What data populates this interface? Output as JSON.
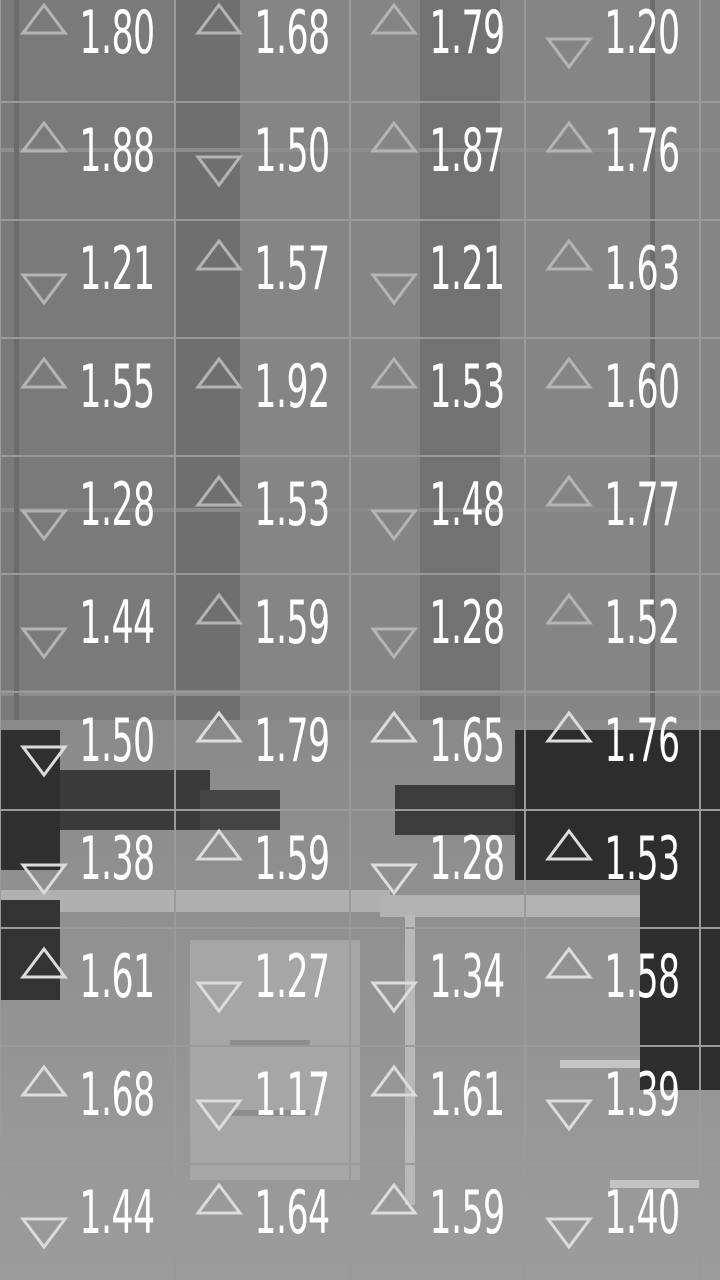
{
  "columns": 4,
  "ticker": [
    [
      {
        "value": "1.80",
        "trend": "up"
      },
      {
        "value": "1.68",
        "trend": "up"
      },
      {
        "value": "1.79",
        "trend": "up"
      },
      {
        "value": "1.20",
        "trend": "down"
      }
    ],
    [
      {
        "value": "1.88",
        "trend": "up"
      },
      {
        "value": "1.50",
        "trend": "down"
      },
      {
        "value": "1.87",
        "trend": "up"
      },
      {
        "value": "1.76",
        "trend": "up"
      }
    ],
    [
      {
        "value": "1.21",
        "trend": "down"
      },
      {
        "value": "1.57",
        "trend": "up"
      },
      {
        "value": "1.21",
        "trend": "down"
      },
      {
        "value": "1.63",
        "trend": "up"
      }
    ],
    [
      {
        "value": "1.55",
        "trend": "up"
      },
      {
        "value": "1.92",
        "trend": "up"
      },
      {
        "value": "1.53",
        "trend": "up"
      },
      {
        "value": "1.60",
        "trend": "up"
      }
    ],
    [
      {
        "value": "1.28",
        "trend": "down"
      },
      {
        "value": "1.53",
        "trend": "up"
      },
      {
        "value": "1.48",
        "trend": "down"
      },
      {
        "value": "1.77",
        "trend": "up"
      }
    ],
    [
      {
        "value": "1.44",
        "trend": "down"
      },
      {
        "value": "1.59",
        "trend": "up"
      },
      {
        "value": "1.28",
        "trend": "down"
      },
      {
        "value": "1.52",
        "trend": "up"
      }
    ],
    [
      {
        "value": "1.50",
        "trend": "down"
      },
      {
        "value": "1.79",
        "trend": "up"
      },
      {
        "value": "1.65",
        "trend": "up"
      },
      {
        "value": "1.76",
        "trend": "up"
      }
    ],
    [
      {
        "value": "1.38",
        "trend": "down"
      },
      {
        "value": "1.59",
        "trend": "up"
      },
      {
        "value": "1.28",
        "trend": "down"
      },
      {
        "value": "1.53",
        "trend": "up"
      }
    ],
    [
      {
        "value": "1.61",
        "trend": "up"
      },
      {
        "value": "1.27",
        "trend": "down"
      },
      {
        "value": "1.34",
        "trend": "down"
      },
      {
        "value": "1.58",
        "trend": "up"
      }
    ],
    [
      {
        "value": "1.68",
        "trend": "up"
      },
      {
        "value": "1.17",
        "trend": "down"
      },
      {
        "value": "1.61",
        "trend": "up"
      },
      {
        "value": "1.39",
        "trend": "down"
      }
    ],
    [
      {
        "value": "1.44",
        "trend": "down"
      },
      {
        "value": "1.64",
        "trend": "up"
      },
      {
        "value": "1.59",
        "trend": "up"
      },
      {
        "value": "1.40",
        "trend": "down"
      }
    ]
  ],
  "colors": {
    "number": "#ffffff",
    "arrow_upper": "#b4b4b4",
    "arrow_lower": "#dcdcdc",
    "grid_line": "#9a9a9a"
  }
}
